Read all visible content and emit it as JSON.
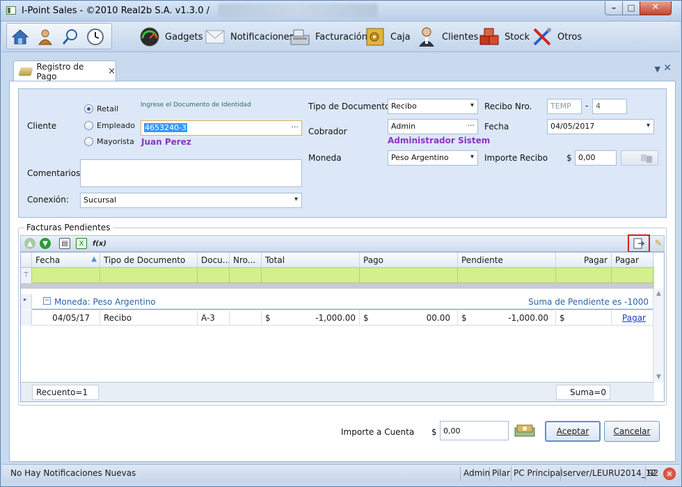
{
  "window": {
    "title": "I-Point Sales  - ©2010 Real2b S.A. v1.3.0 /"
  },
  "ribbon": {
    "items": [
      {
        "label": "Gadgets",
        "icon": "gauge-icon"
      },
      {
        "label": "Notificaciones",
        "icon": "envelope-icon"
      },
      {
        "label": "Facturación",
        "icon": "cash-register-icon"
      },
      {
        "label": "Caja",
        "icon": "safe-icon"
      },
      {
        "label": "Clientes",
        "icon": "person-icon"
      },
      {
        "label": "Stock",
        "icon": "boxes-icon"
      },
      {
        "label": "Otros",
        "icon": "tools-icon"
      }
    ],
    "quick": [
      "home-icon",
      "users-icon",
      "search-icon",
      "clock-icon"
    ]
  },
  "tab": {
    "label": "Registro de Pago",
    "close": "×"
  },
  "form": {
    "cliente_label": "Cliente",
    "radio_options": [
      "Retail",
      "Empleado",
      "Mayorista"
    ],
    "selected_option": "Retail",
    "doc_hint": "Ingrese el Documento de Identidad",
    "doc_value": "4653240-3",
    "client_name": "Juan Perez",
    "comentarios_label": "Comentarios",
    "comentarios_value": "",
    "conexion_label": "Conexión:",
    "conexion_value": "Sucursal",
    "tipo_doc_label": "Tipo de Documento",
    "tipo_doc_value": "Recibo",
    "cobrador_label": "Cobrador",
    "cobrador_value": "Admin",
    "cobrador_name": "Administrador Sistem",
    "moneda_label": "Moneda",
    "moneda_value": "Peso Argentino",
    "recibo_label": "Recibo Nro.",
    "recibo_prefix": "TEMP",
    "recibo_dash": "-",
    "recibo_num": "4",
    "fecha_label": "Fecha",
    "fecha_value": "04/05/2017",
    "importe_label": "Importe Recibo",
    "currency": "$",
    "importe_value": "0,00"
  },
  "facturas": {
    "title": "Facturas Pendientes",
    "columns": [
      "Fecha",
      "Tipo de Documento",
      "Docu...",
      "Nro...",
      "Total",
      "Pago",
      "Pendiente",
      "Pagar",
      "Pagar"
    ],
    "group_label": "Moneda: Peso Argentino",
    "group_summary": "Suma de Pendiente es -1000",
    "rows": [
      {
        "fecha": "04/05/17",
        "tipo": "Recibo",
        "docu": "A-3",
        "nro": "",
        "total_cur": "$",
        "total": "-1,000.00",
        "pago_cur": "$",
        "pago": "00.00",
        "pend_cur": "$",
        "pendiente": "-1,000.00",
        "pagar_cur": "$",
        "pagar_link": "Pagar"
      }
    ],
    "count_label": "Recuento=1",
    "sum_label": "Suma=0"
  },
  "bottom": {
    "importe_cuenta_label": "Importe a Cuenta",
    "currency": "$",
    "importe_cuenta_value": "0,00",
    "aceptar_label": "Aceptar",
    "cancelar_label": "Cancelar"
  },
  "status": {
    "notifications": "No Hay Notificaciones Nuevas",
    "user": "Admin",
    "branch": "Pilar",
    "pc": "PC Principal",
    "server": "server/LEURU2014_12",
    "number": "92"
  }
}
